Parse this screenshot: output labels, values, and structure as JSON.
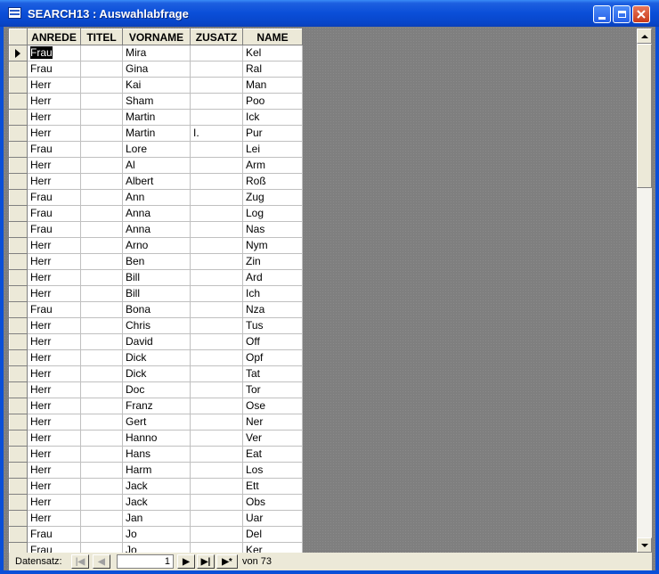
{
  "window": {
    "title": "SEARCH13 : Auswahlabfrage"
  },
  "columns": [
    "ANREDE",
    "TITEL",
    "VORNAME",
    "ZUSATZ",
    "NAME"
  ],
  "rows": [
    {
      "anrede": "Frau",
      "titel": "",
      "vorname": "Mira",
      "zusatz": "",
      "name": "Kel"
    },
    {
      "anrede": "Frau",
      "titel": "",
      "vorname": "Gina",
      "zusatz": "",
      "name": "Ral"
    },
    {
      "anrede": "Herr",
      "titel": "",
      "vorname": "Kai",
      "zusatz": "",
      "name": "Man"
    },
    {
      "anrede": "Herr",
      "titel": "",
      "vorname": "Sham",
      "zusatz": "",
      "name": "Poo"
    },
    {
      "anrede": "Herr",
      "titel": "",
      "vorname": "Martin",
      "zusatz": "",
      "name": "Ick"
    },
    {
      "anrede": "Herr",
      "titel": "",
      "vorname": "Martin",
      "zusatz": "I.",
      "name": "Pur"
    },
    {
      "anrede": "Frau",
      "titel": "",
      "vorname": "Lore",
      "zusatz": "",
      "name": "Lei"
    },
    {
      "anrede": "Herr",
      "titel": "",
      "vorname": "Al",
      "zusatz": "",
      "name": "Arm"
    },
    {
      "anrede": "Herr",
      "titel": "",
      "vorname": "Albert",
      "zusatz": "",
      "name": "Roß"
    },
    {
      "anrede": "Frau",
      "titel": "",
      "vorname": "Ann",
      "zusatz": "",
      "name": "Zug"
    },
    {
      "anrede": "Frau",
      "titel": "",
      "vorname": "Anna",
      "zusatz": "",
      "name": "Log"
    },
    {
      "anrede": "Frau",
      "titel": "",
      "vorname": "Anna",
      "zusatz": "",
      "name": "Nas"
    },
    {
      "anrede": "Herr",
      "titel": "",
      "vorname": "Arno",
      "zusatz": "",
      "name": "Nym"
    },
    {
      "anrede": "Herr",
      "titel": "",
      "vorname": "Ben",
      "zusatz": "",
      "name": "Zin"
    },
    {
      "anrede": "Herr",
      "titel": "",
      "vorname": "Bill",
      "zusatz": "",
      "name": "Ard"
    },
    {
      "anrede": "Herr",
      "titel": "",
      "vorname": "Bill",
      "zusatz": "",
      "name": "Ich"
    },
    {
      "anrede": "Frau",
      "titel": "",
      "vorname": "Bona",
      "zusatz": "",
      "name": "Nza"
    },
    {
      "anrede": "Herr",
      "titel": "",
      "vorname": "Chris",
      "zusatz": "",
      "name": "Tus"
    },
    {
      "anrede": "Herr",
      "titel": "",
      "vorname": "David",
      "zusatz": "",
      "name": "Off"
    },
    {
      "anrede": "Herr",
      "titel": "",
      "vorname": "Dick",
      "zusatz": "",
      "name": "Opf"
    },
    {
      "anrede": "Herr",
      "titel": "",
      "vorname": "Dick",
      "zusatz": "",
      "name": "Tat"
    },
    {
      "anrede": "Herr",
      "titel": "",
      "vorname": "Doc",
      "zusatz": "",
      "name": "Tor"
    },
    {
      "anrede": "Herr",
      "titel": "",
      "vorname": "Franz",
      "zusatz": "",
      "name": "Ose"
    },
    {
      "anrede": "Herr",
      "titel": "",
      "vorname": "Gert",
      "zusatz": "",
      "name": "Ner"
    },
    {
      "anrede": "Herr",
      "titel": "",
      "vorname": "Hanno",
      "zusatz": "",
      "name": "Ver"
    },
    {
      "anrede": "Herr",
      "titel": "",
      "vorname": "Hans",
      "zusatz": "",
      "name": "Eat"
    },
    {
      "anrede": "Herr",
      "titel": "",
      "vorname": "Harm",
      "zusatz": "",
      "name": "Los"
    },
    {
      "anrede": "Herr",
      "titel": "",
      "vorname": "Jack",
      "zusatz": "",
      "name": "Ett"
    },
    {
      "anrede": "Herr",
      "titel": "",
      "vorname": "Jack",
      "zusatz": "",
      "name": "Obs"
    },
    {
      "anrede": "Herr",
      "titel": "",
      "vorname": "Jan",
      "zusatz": "",
      "name": "Uar"
    },
    {
      "anrede": "Frau",
      "titel": "",
      "vorname": "Jo",
      "zusatz": "",
      "name": "Del"
    },
    {
      "anrede": "Frau",
      "titel": "",
      "vorname": "Jo",
      "zusatz": "",
      "name": "Ker"
    }
  ],
  "navigation": {
    "label": "Datensatz:",
    "current_record": "1",
    "total_text": "von 73",
    "first_icon": "first-record-icon",
    "prev_icon": "previous-record-icon",
    "next_icon": "next-record-icon",
    "last_icon": "last-record-icon",
    "new_icon": "new-record-icon"
  },
  "colors": {
    "titlebar": "#0a4ed8",
    "selection_bg": "#000000",
    "selection_text": "#ffffff"
  }
}
